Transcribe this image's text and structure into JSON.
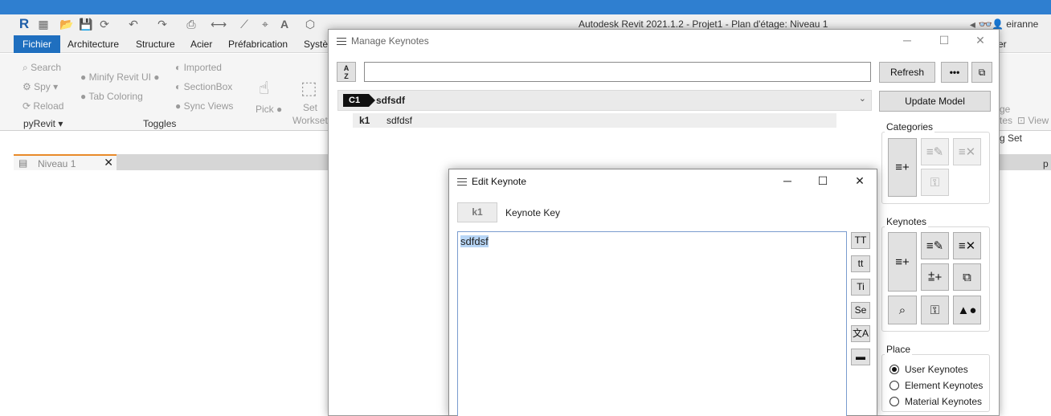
{
  "app": {
    "title": "Autodesk Revit 2021.1.2 - Projet1 - Plan d'étage: Niveau 1",
    "user": "eiranne",
    "logo": "R",
    "menus": [
      "Fichier",
      "Architecture",
      "Structure",
      "Acier",
      "Préfabrication",
      "Systè"
    ],
    "menu_right_fragment": "er",
    "ribbon": {
      "search": "Search",
      "spy": "Spy",
      "reload": "Reload",
      "pyrevit": "pyRevit",
      "minify": "Minify Revit UI",
      "tab_coloring": "Tab Coloring",
      "imported": "Imported",
      "sectionbox": "SectionBox",
      "sync_views": "Sync Views",
      "toggles": "Toggles",
      "pick": "Pick",
      "set": "Set",
      "workset": "Workset",
      "frag_ge": "ge",
      "frag_tes": "tes",
      "frag_view": "View",
      "frag_gset": "g Set"
    },
    "doc_tab": "Niveau 1",
    "right_fragment": "p"
  },
  "manage_keynotes": {
    "title": "Manage Keynotes",
    "search_value": "",
    "sort_icon_top": "A",
    "sort_icon_bottom": "Z",
    "refresh": "Refresh",
    "more": "•••",
    "update_model": "Update Model",
    "category": {
      "key": "C1",
      "name": "sdfsdf"
    },
    "keynote": {
      "key": "k1",
      "text": "sdfdsf"
    },
    "groups": {
      "categories": "Categories",
      "keynotes": "Keynotes",
      "place": "Place"
    },
    "place_options": [
      "User Keynotes",
      "Element Keynotes",
      "Material Keynotes"
    ],
    "place_selected": "User Keynotes"
  },
  "edit_keynote": {
    "title": "Edit Keynote",
    "key": "k1",
    "key_label": "Keynote Key",
    "text": "sdfdsf",
    "format_buttons": [
      "TT",
      "tt",
      "Ti",
      "Se"
    ]
  }
}
